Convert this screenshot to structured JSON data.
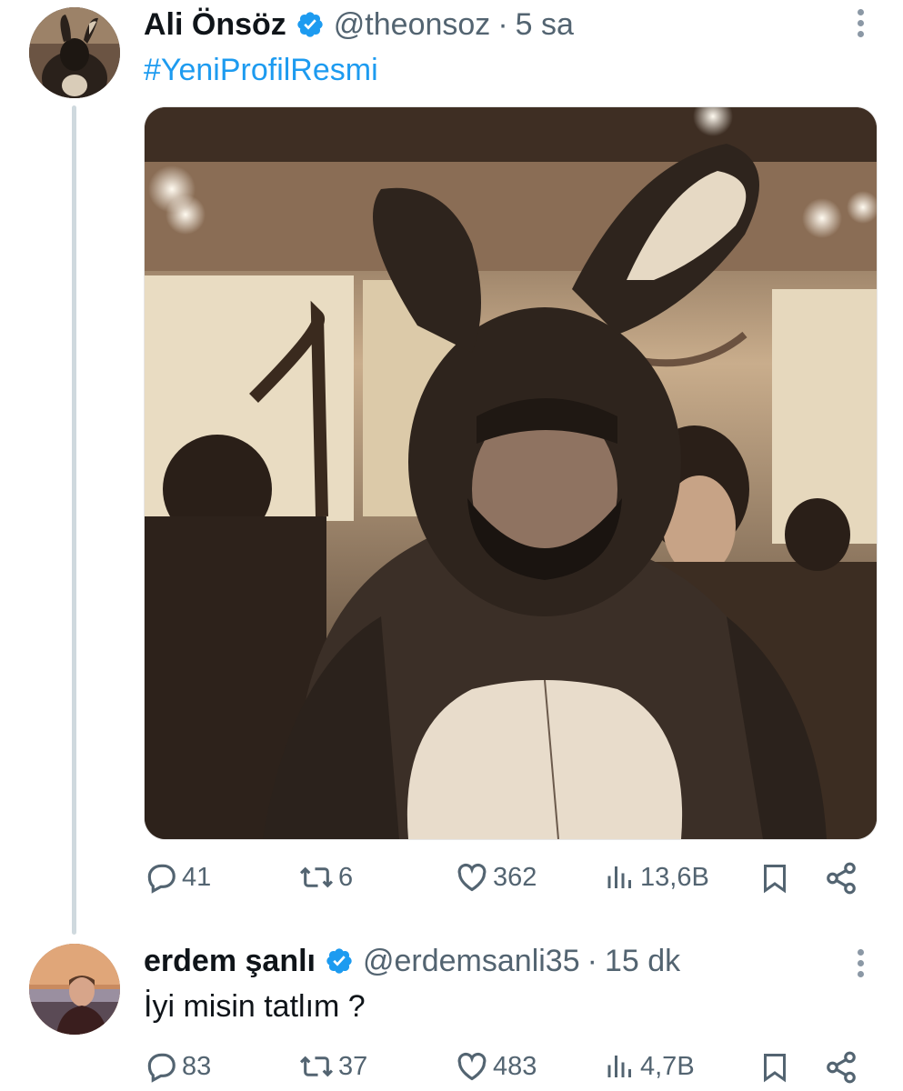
{
  "tweets": [
    {
      "author_name": "Ali Önsöz",
      "handle": "@theonsoz",
      "separator": "·",
      "time": "5 sa",
      "text": "#YeniProfilResmi",
      "verified": true,
      "media": "photo of a person in a dark furry bunny costume at a party",
      "actions": {
        "replies": "41",
        "retweets": "6",
        "likes": "362",
        "views": "13,6B"
      }
    },
    {
      "author_name": "erdem şanlı",
      "handle": "@erdemsanli35",
      "separator": "·",
      "time": "15 dk",
      "text": "İyi misin tatlım ?",
      "verified": true,
      "actions": {
        "replies": "83",
        "retweets": "37",
        "likes": "483",
        "views": "4,7B"
      }
    }
  ],
  "colors": {
    "link": "#1d9bf0",
    "secondary": "#536471",
    "verified": "#1d9bf0",
    "thread_line": "#cfd9de"
  },
  "icons": [
    "reply-icon",
    "retweet-icon",
    "like-icon",
    "views-icon",
    "bookmark-icon",
    "share-icon",
    "more-icon",
    "verified-icon"
  ]
}
